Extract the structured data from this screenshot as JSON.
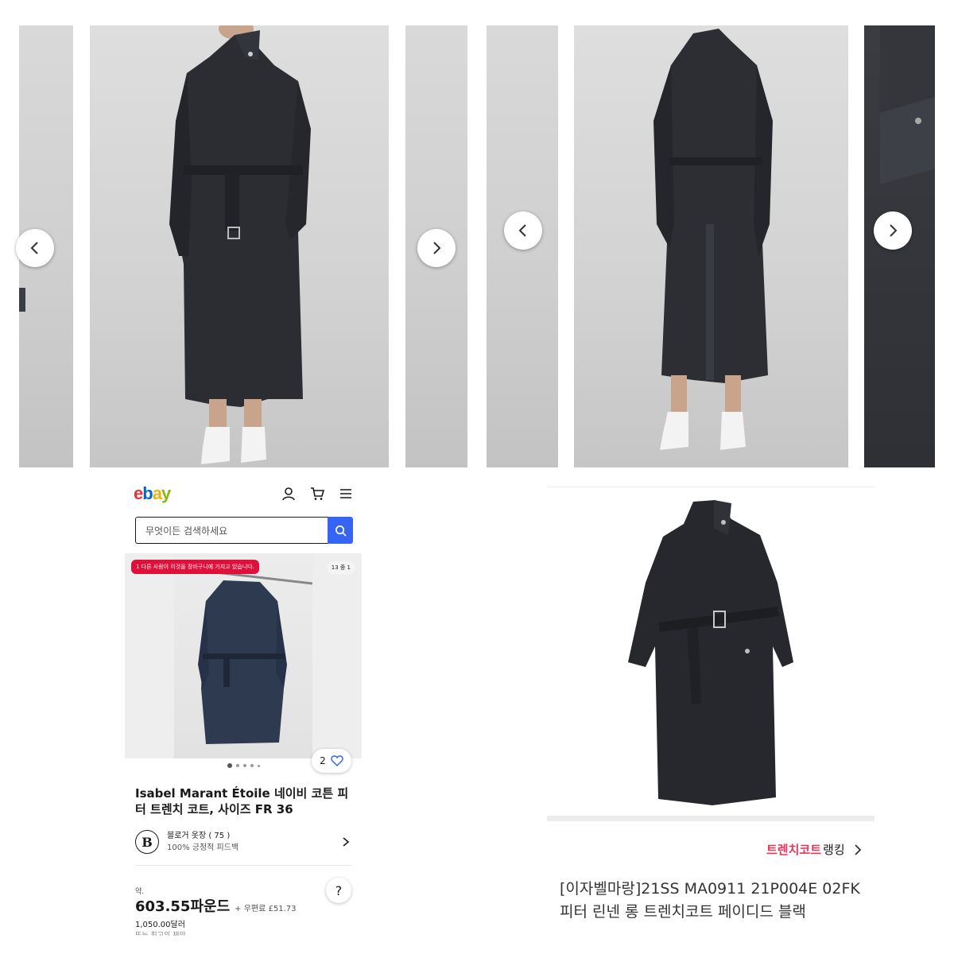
{
  "gallery": {
    "prev_label": "‹",
    "next_label": "›"
  },
  "ebay": {
    "logo": {
      "e": "e",
      "b": "b",
      "a": "a",
      "y": "y"
    },
    "icons": [
      "account-icon",
      "cart-icon",
      "menu-icon"
    ],
    "search_placeholder": "무엇이든 검색하세요",
    "cart_badge": "1 다른 사람이 이것을 장바구니에 가지고 있습니다.",
    "image_count": "13 중 1",
    "watch_count": "2",
    "title": "Isabel Marant Étoile 네이비 코튼 피터 트렌치 코트, 사이즈 FR 36",
    "seller_name": "블로거 옷장 ( 75 )",
    "seller_feedback": "100% 긍정적 피드백",
    "avatar_letter": "B",
    "approx_label": "약.",
    "price": "603.55파운드",
    "shipping": "+ 우편료 £51.73",
    "usd_price": "1,050.00달러",
    "offer_text": "또는 최고의 제안",
    "help_label": "?"
  },
  "product": {
    "ranking_hot": "트렌치코트",
    "ranking_label": "랭킹",
    "name_line1": "[이자벨마랑]21SS MA0911 21P004E 02FK",
    "name_line2": "피터 린넨 롱 트렌치코트 페이디드 블랙"
  },
  "colors": {
    "ebay_blue": "#3665f3",
    "cart_badge": "#e0103a",
    "ranking_pink": "#e8365a",
    "coat": "#2b2d33"
  }
}
